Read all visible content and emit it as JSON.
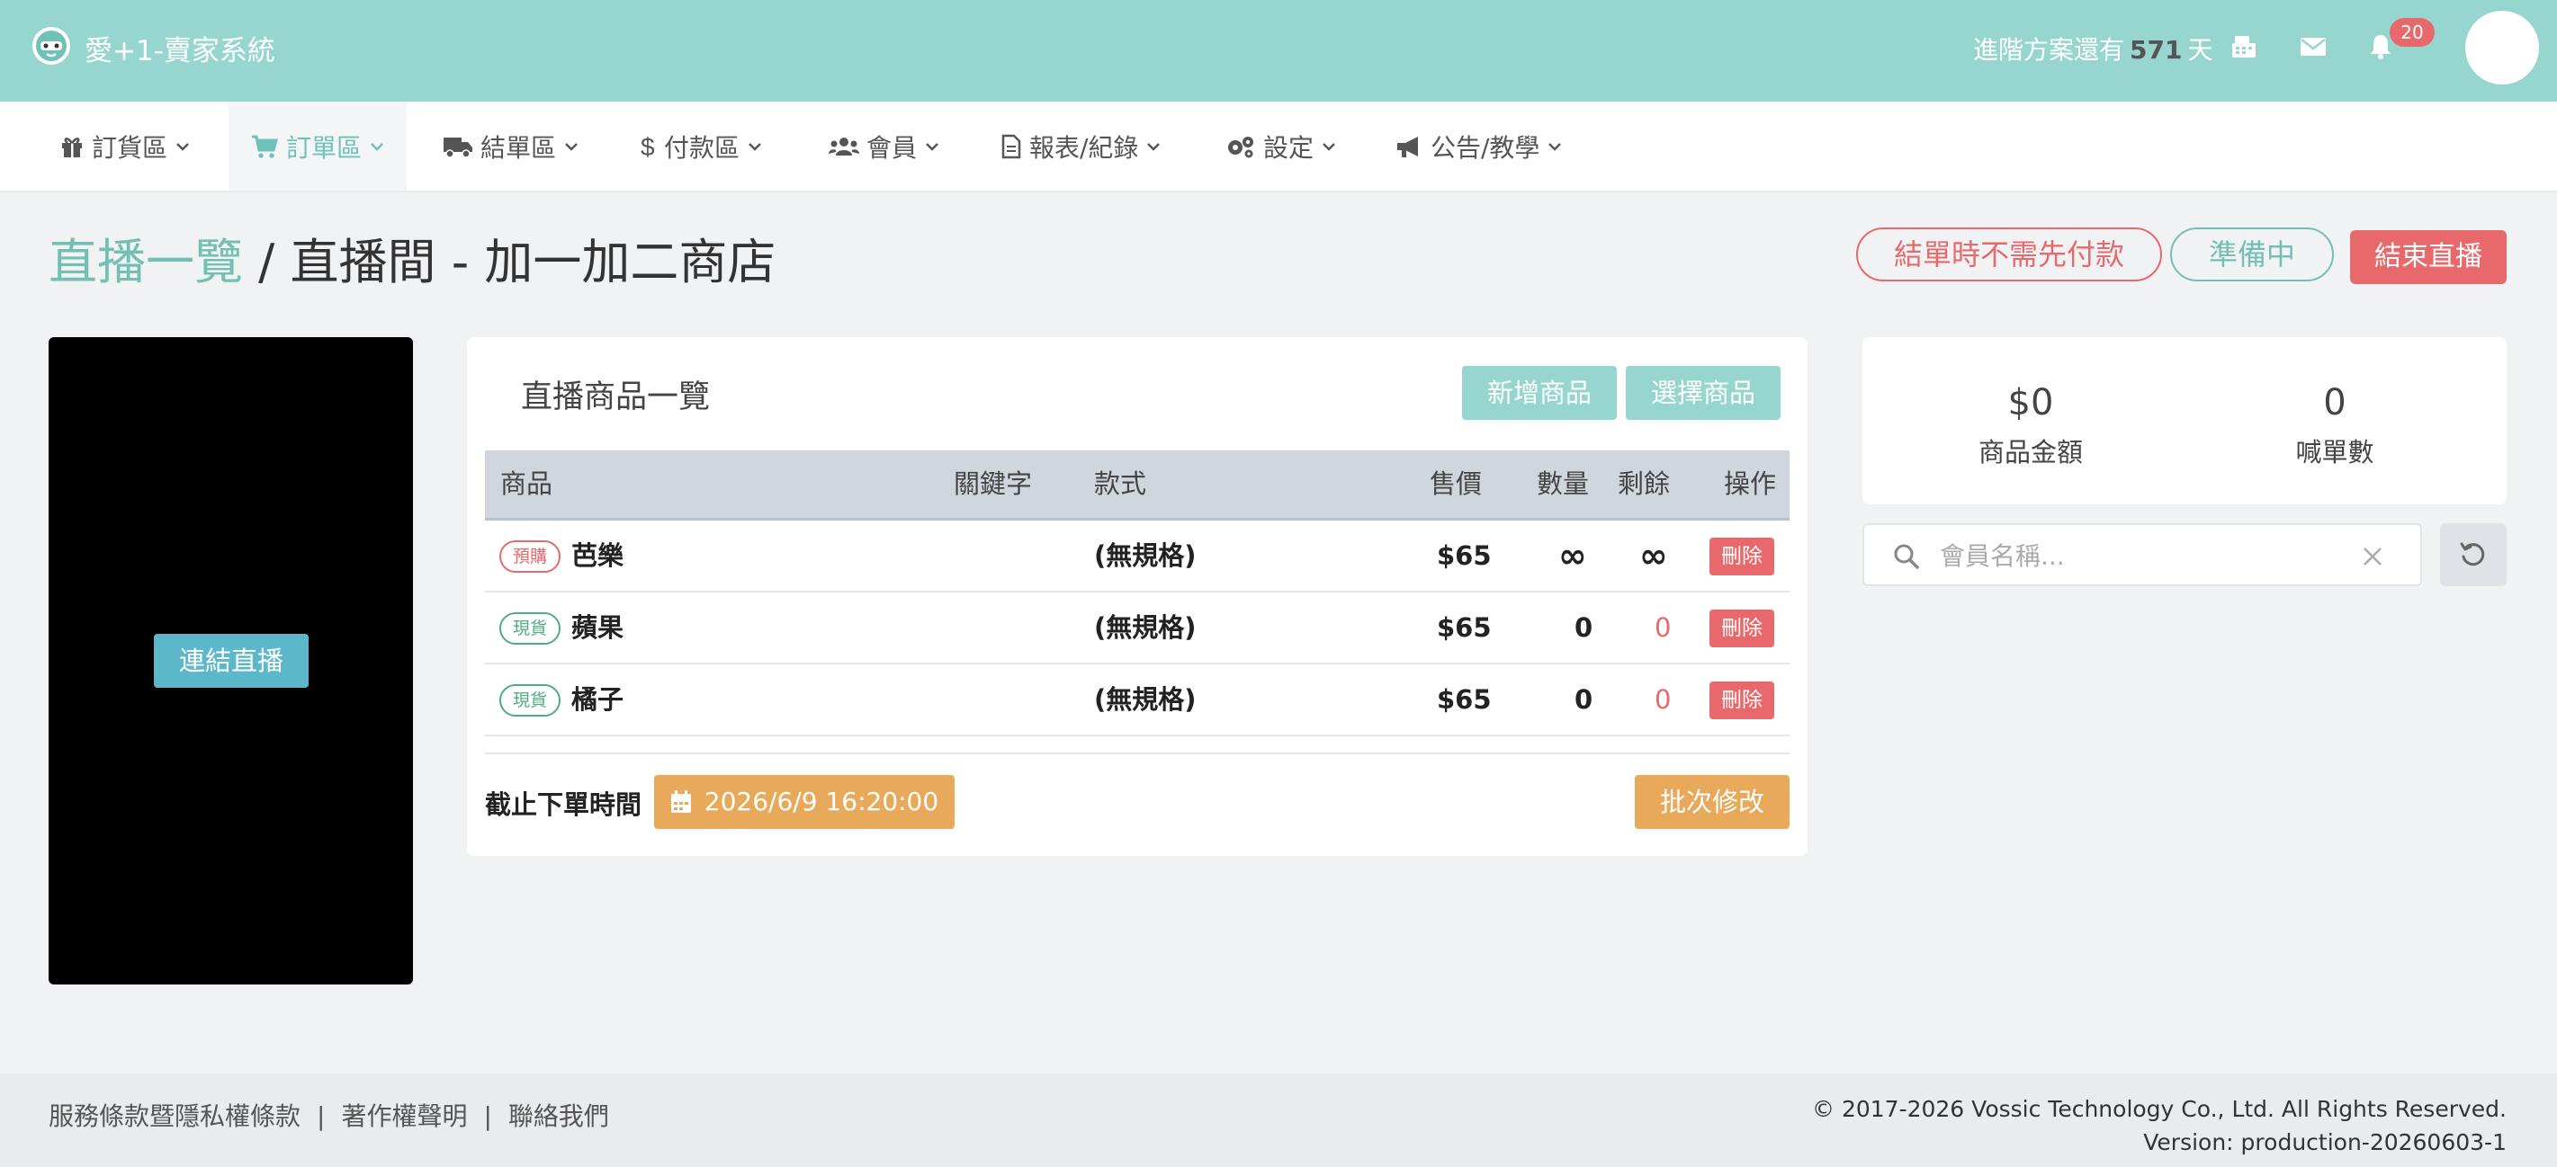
{
  "header": {
    "app_title": "愛+1-賣家系統",
    "plan_prefix": "進階方案還有",
    "plan_days": "571",
    "plan_suffix": "天",
    "notification_count": "20",
    "icons": [
      "logo-icon",
      "register-icon",
      "mail-icon",
      "bell-icon"
    ]
  },
  "nav": {
    "items": [
      {
        "label": "訂貨區",
        "icon": "gift-icon"
      },
      {
        "label": "訂單區",
        "icon": "cart-icon",
        "active": true
      },
      {
        "label": "結單區",
        "icon": "truck-icon"
      },
      {
        "label": "付款區",
        "icon": "dollar-icon"
      },
      {
        "label": "會員",
        "icon": "users-icon"
      },
      {
        "label": "報表/紀錄",
        "icon": "file-icon"
      },
      {
        "label": "設定",
        "icon": "gears-icon"
      },
      {
        "label": "公告/教學",
        "icon": "megaphone-icon"
      }
    ]
  },
  "page": {
    "breadcrumb_link": "直播一覽",
    "title": " / 直播間 - 加一加二商店",
    "status_pay": "結單時不需先付款",
    "status_state": "準備中",
    "end_live_label": "結束直播"
  },
  "video": {
    "connect_label": "連結直播"
  },
  "products": {
    "title": "直播商品一覽",
    "add_label": "新增商品",
    "select_label": "選擇商品",
    "columns": [
      "商品",
      "關鍵字",
      "款式",
      "售價",
      "數量",
      "剩餘",
      "操作"
    ],
    "rows": [
      {
        "tag": "預購",
        "tag_type": "pre",
        "name": "芭樂",
        "keyword": "",
        "style": "(無規格)",
        "price": "$65",
        "qty": "∞",
        "remain": "∞",
        "action": "刪除"
      },
      {
        "tag": "現貨",
        "tag_type": "stock",
        "name": "蘋果",
        "keyword": "",
        "style": "(無規格)",
        "price": "$65",
        "qty": "0",
        "remain": "0",
        "action": "刪除"
      },
      {
        "tag": "現貨",
        "tag_type": "stock",
        "name": "橘子",
        "keyword": "",
        "style": "(無規格)",
        "price": "$65",
        "qty": "0",
        "remain": "0",
        "action": "刪除"
      }
    ],
    "deadline_label": "截止下單時間",
    "deadline_value": "2026/6/9 16:20:00",
    "batch_label": "批次修改"
  },
  "stats": {
    "amount_value": "$0",
    "amount_label": "商品金額",
    "orders_value": "0",
    "orders_label": "喊單數"
  },
  "search": {
    "placeholder": "會員名稱..."
  },
  "footer": {
    "terms": "服務條款暨隱私權條款",
    "copyright_notice": "著作權聲明",
    "contact": "聯絡我們",
    "sep": "|",
    "copyright": "© 2017-2026 Vossic Technology Co., Ltd. All Rights Reserved.",
    "version": "Version: production-20260603-1"
  },
  "colors": {
    "header_bg": "#96d6ce",
    "accent_teal": "#73c0b3",
    "danger": "#e8696b",
    "warning": "#e8a95a",
    "stock_green": "#4fae7e"
  }
}
